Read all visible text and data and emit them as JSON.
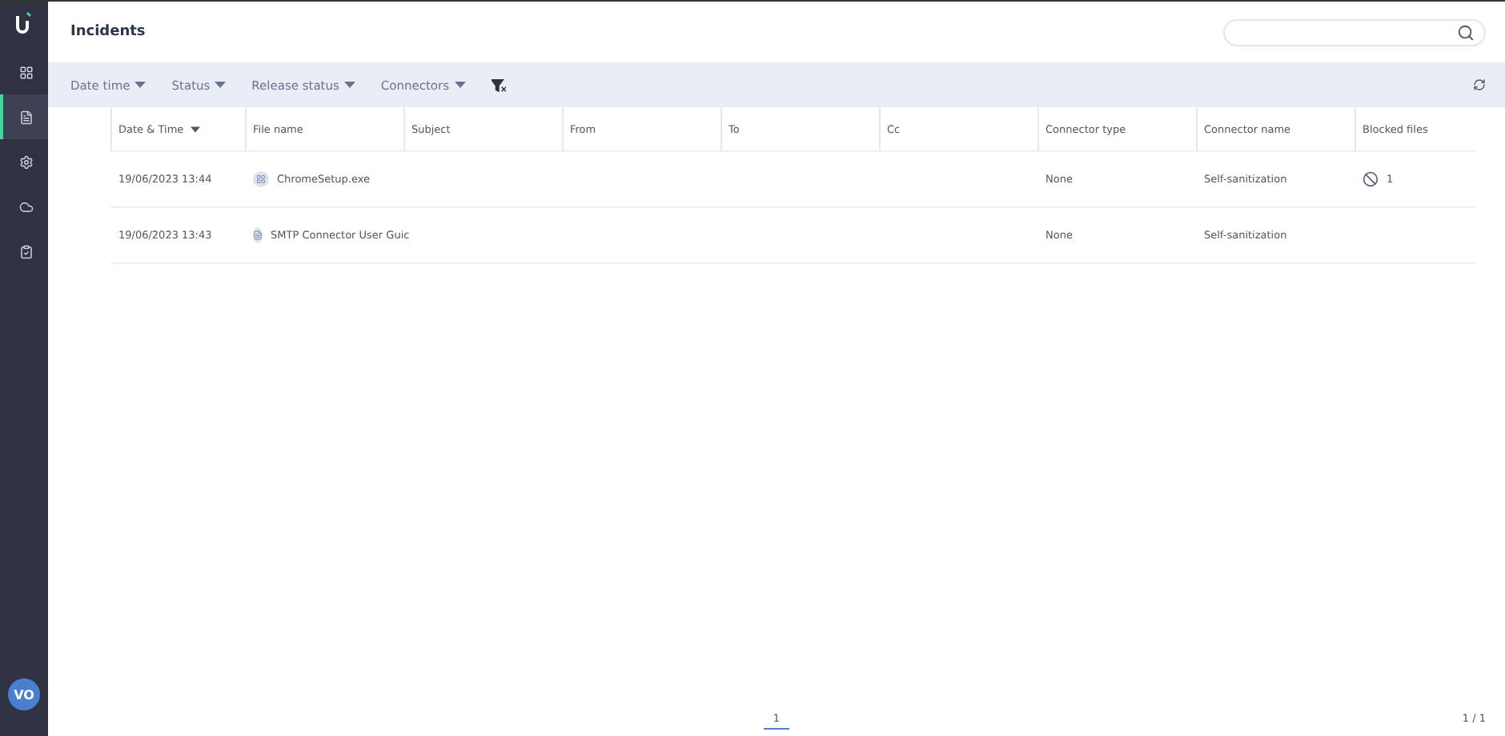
{
  "sidebar": {
    "avatar": "VO",
    "items": [
      {
        "kind": "dashboard",
        "selected": false
      },
      {
        "kind": "incidents",
        "selected": true
      },
      {
        "kind": "settings",
        "selected": false
      },
      {
        "kind": "cloud",
        "selected": false
      },
      {
        "kind": "reports",
        "selected": false
      }
    ]
  },
  "header": {
    "title": "Incidents"
  },
  "filters": [
    "Date time",
    "Status",
    "Release status",
    "Connectors"
  ],
  "table": {
    "columns": [
      {
        "label": "Date & Time",
        "sortable": true
      },
      {
        "label": "File name",
        "sortable": false
      },
      {
        "label": "Subject",
        "sortable": false
      },
      {
        "label": "From",
        "sortable": false
      },
      {
        "label": "To",
        "sortable": false
      },
      {
        "label": "Cc",
        "sortable": false
      },
      {
        "label": "Connector type",
        "sortable": false
      },
      {
        "label": "Connector name",
        "sortable": false
      },
      {
        "label": "Blocked files",
        "sortable": false
      }
    ],
    "rows": [
      {
        "date_time": "19/06/2023 13:44",
        "file_name": "ChromeSetup.exe",
        "kind": "binary",
        "connector_type": "None",
        "connector_name": "Self-sanitization",
        "blocked_files": "1"
      },
      {
        "date_time": "19/06/2023 13:43",
        "file_name": "SMTP Connector User Guic",
        "kind": "document",
        "connector_type": "None",
        "connector_name": "Self-sanitization"
      }
    ]
  },
  "pagination": {
    "pages": [
      {
        "label": "1",
        "selected": true
      }
    ],
    "page_count": "1 / 1"
  }
}
